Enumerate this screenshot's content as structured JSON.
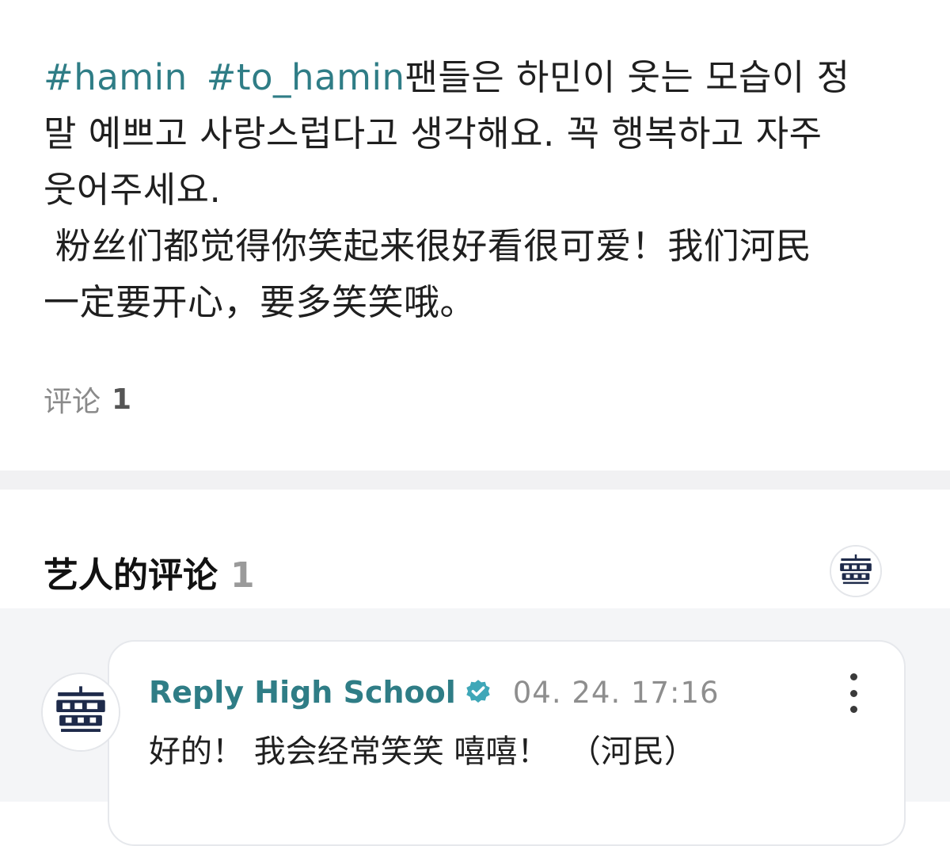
{
  "post": {
    "hashtags": [
      "#hamin",
      "#to_hamin"
    ],
    "body_line1_rest": "팬들은 하민이 웃는 모습이 정",
    "body_line2": "말 예쁘고 사랑스럽다고 생각해요. 꼭 행복하고 자주",
    "body_line3": "웃어주세요.",
    "body_line4": " 粉丝们都觉得你笑起来很好看很可爱！我们河民",
    "body_line5": "一定要开心，要多笑笑哦。",
    "comment_label": "评论",
    "comment_count": "1"
  },
  "artist_comments": {
    "title": "艺人的评论",
    "count": "1",
    "avatar_icon": "reply-high-school-logo-icon"
  },
  "comment": {
    "author": "Reply High School",
    "verified_icon": "verified-badge-icon",
    "timestamp": "04. 24. 17:16",
    "text": "好的！ 我会经常笑笑 嘻嘻！  （河民）",
    "more_icon": "more-vertical-icon"
  },
  "colors": {
    "hashtag": "#2f7d86",
    "author": "#2f7d86",
    "verified_badge": "#3fa7b8",
    "divider": "#f1f1f3",
    "comment_area_bg": "#f4f5f7",
    "logo_navy": "#1e2a4a"
  }
}
